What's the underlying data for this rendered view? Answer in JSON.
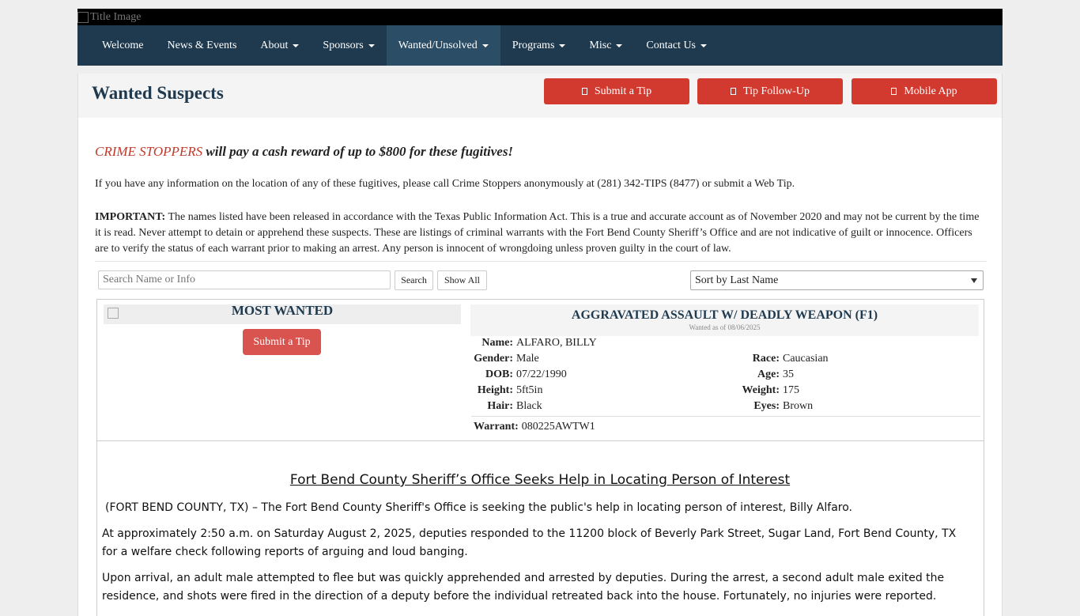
{
  "header": {
    "title_image_alt": "Title Image"
  },
  "nav": {
    "items": [
      {
        "label": "Welcome"
      },
      {
        "label": "News & Events"
      },
      {
        "label": "About"
      },
      {
        "label": "Sponsors"
      },
      {
        "label": "Wanted/Unsolved"
      },
      {
        "label": "Programs"
      },
      {
        "label": "Misc"
      },
      {
        "label": "Contact Us"
      }
    ]
  },
  "page": {
    "title": "Wanted Suspects",
    "buttons": {
      "submit_tip": "Submit a Tip",
      "tip_followup": "Tip Follow-Up",
      "mobile_app": "Mobile App"
    }
  },
  "intro": {
    "crime_stoppers": "CRIME STOPPERS",
    "reward_text": " will pay a cash reward of up to $800 for these fugitives!",
    "info": "If you have any information on the location of any of these fugitives, please call Crime Stoppers anonymously at (281) 342-TIPS (8477) or submit a Web Tip.",
    "important_label": "IMPORTANT:",
    "important_text": " The names listed have been released in accordance with the Texas Public Information Act. This is a true and accurate account as of November 2020 and may not be current by the time it is read.  Never attempt to detain or apprehend these suspects.  These are listings of criminal warrants with the Fort Bend County Sheriff’s Office and are not indicative of guilt or innocence.  Officers are to verify the status of each warrant prior to making an arrest.  Any person is innocent of wrongdoing unless proven guilty in the court of law."
  },
  "search": {
    "placeholder": "Search Name or Info",
    "search_button": "Search",
    "show_all_button": "Show All",
    "sort_selected": "Sort by Last Name"
  },
  "suspect": {
    "banner": "MOST WANTED",
    "submit_tip": "Submit a Tip",
    "charge": "AGGRAVATED ASSAULT W/ DEADLY WEAPON (F1)",
    "wanted_as_of": "Wanted as of 08/06/2025",
    "name_label": "Name:",
    "name": "ALFARO, BILLY",
    "gender_label": "Gender:",
    "gender": "Male",
    "race_label": "Race:",
    "race": "Caucasian",
    "dob_label": "DOB:",
    "dob": "07/22/1990",
    "age_label": "Age:",
    "age": "35",
    "height_label": "Height:",
    "height": "5ft5in",
    "weight_label": "Weight:",
    "weight": "175",
    "hair_label": "Hair:",
    "hair": "Black",
    "eyes_label": "Eyes:",
    "eyes": "Brown",
    "warrant_label": "Warrant:",
    "warrant": "080225AWTW1"
  },
  "article": {
    "headline": "Fort Bend County Sheriff’s Office Seeks Help in Locating Person of Interest",
    "p1_lead": "(FORT BEND COUNTY, TX)",
    "p1_text": " – The Fort Bend County Sheriff's Office is seeking the public's help in locating person of interest, Billy Alfaro.",
    "p2": "At approximately 2:50 a.m. on Saturday August 2, 2025, deputies responded to the 11200 block of Beverly Park Street, Sugar Land, Fort Bend County, TX for a welfare check following reports of arguing and loud banging.",
    "p3": "Upon arrival, an adult male attempted to flee but was quickly apprehended and arrested by deputies. During the arrest, a second adult male exited the residence, and shots were fired in the direction of a deputy before the individual retreated back into the house. Fortunately, no injuries were reported."
  }
}
